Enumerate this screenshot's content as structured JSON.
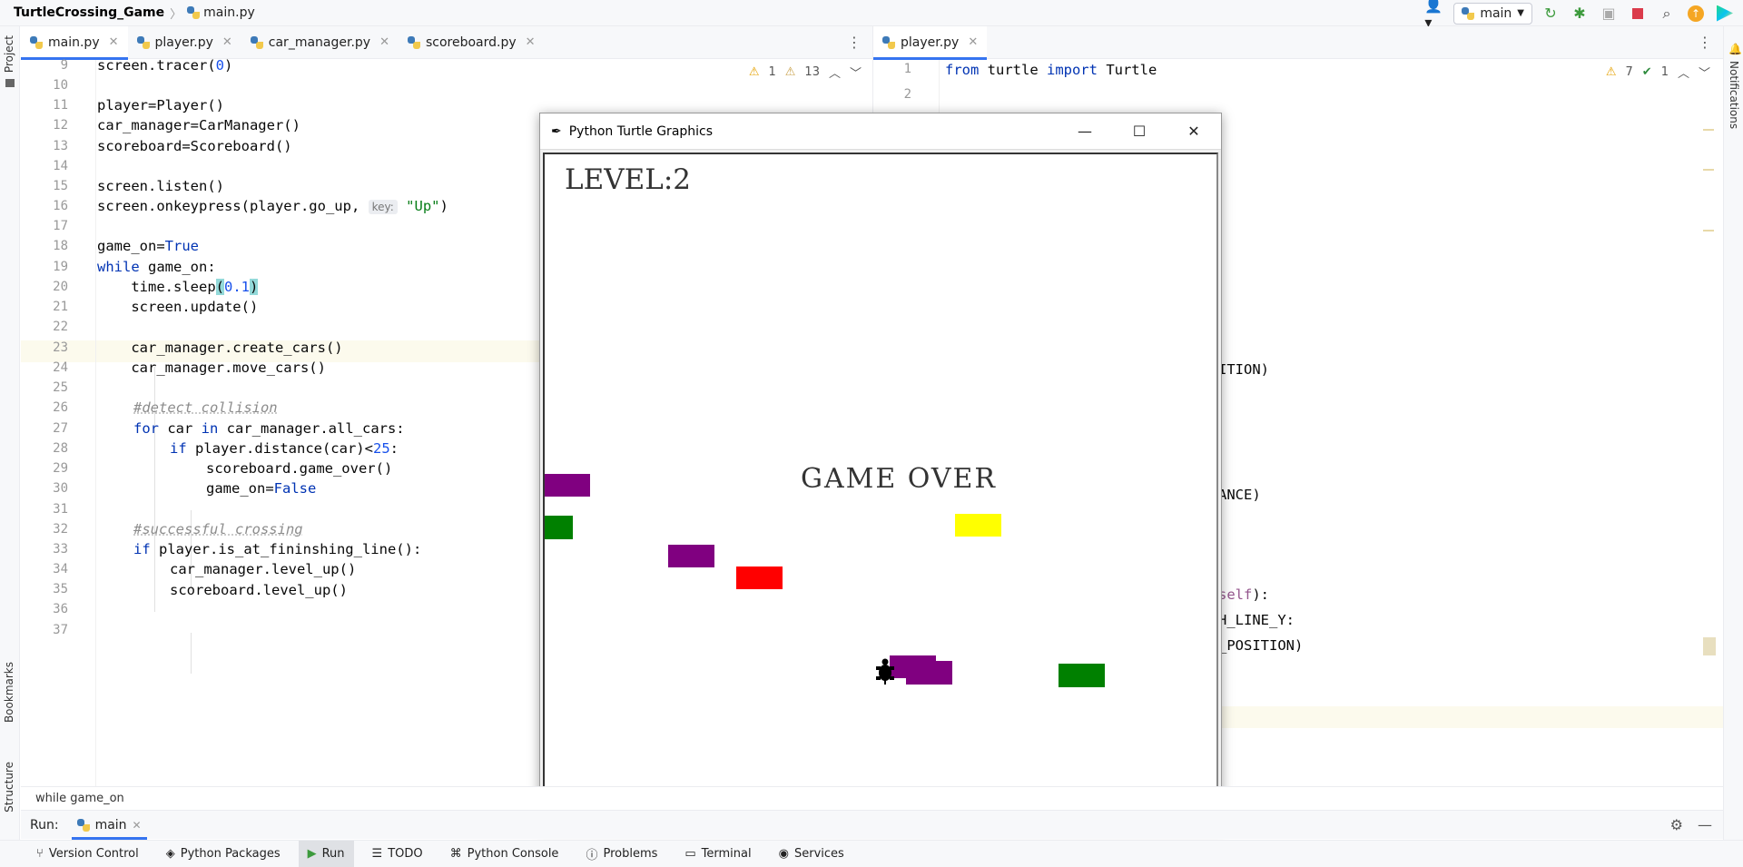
{
  "titlebar": {
    "project": "TurtleCrossing_Game",
    "file": "main.py",
    "branch": "main",
    "icons": [
      "user-icon",
      "run-icon",
      "debug-icon",
      "coverage-icon",
      "stop-icon",
      "search-icon",
      "update-icon",
      "ide-logo-icon"
    ]
  },
  "left_tool_labels": {
    "project": "Project",
    "bookmarks": "Bookmarks",
    "structure": "Structure"
  },
  "right_tool_labels": {
    "notifications": "Notifications"
  },
  "left_tabs": [
    {
      "label": "main.py",
      "active": true
    },
    {
      "label": "player.py",
      "active": false
    },
    {
      "label": "car_manager.py",
      "active": false
    },
    {
      "label": "scoreboard.py",
      "active": false
    }
  ],
  "right_tabs": [
    {
      "label": "player.py",
      "active": true
    }
  ],
  "left_editor": {
    "warnings": "1",
    "weak_warnings": "13",
    "line_numbers": [
      "9",
      "10",
      "11",
      "12",
      "13",
      "14",
      "15",
      "16",
      "17",
      "18",
      "19",
      "20",
      "21",
      "22",
      "23",
      "24",
      "25",
      "26",
      "27",
      "28",
      "29",
      "30",
      "31",
      "32",
      "33",
      "34",
      "35",
      "36",
      "37"
    ],
    "lines": {
      "l9": "screen.tracer(",
      "l9_num": "0",
      "l9_end": ")",
      "l11": "player=Player()",
      "l12": "car_manager=CarManager()",
      "l13": "scoreboard=Scoreboard()",
      "l15": "screen.listen()",
      "l16a": "screen.onkeypress(player.go_up, ",
      "l16_hint": "key:",
      "l16_str": "\"Up\"",
      "l16_end": ")",
      "l18a": "game_on=",
      "l18_kw": "True",
      "l19_kw": "while",
      "l19b": " game_on:",
      "l20a": "    time.sleep",
      "l20_open": "(",
      "l20_num": "0.1",
      "l20_close": ")",
      "l21": "    screen.update()",
      "l23": "    car_manager.create_cars()",
      "l24": "    car_manager.move_cars()",
      "l26": "#detect collision",
      "l27_kw1": "for",
      "l27b": " car ",
      "l27_kw2": "in",
      "l27c": " car_manager.all_cars:",
      "l28_kw": "if",
      "l28b": " player.distance(car)<",
      "l28_num": "25",
      "l28c": ":",
      "l29": "scoreboard.game_over()",
      "l30a": "game_on=",
      "l30_kw": "False",
      "l32": "#successful crossing",
      "l33_kw": "if",
      "l33b": " player.is_at_fininshing_line():",
      "l34": "car_manager.level_up()",
      "l35": "scoreboard.level_up()"
    }
  },
  "right_editor": {
    "warnings": "7",
    "checks": "1",
    "line_numbers": [
      "1",
      "2"
    ],
    "line1_kw1": "from",
    "line1_mid": " turtle ",
    "line1_kw2": "import",
    "line1_end": " Turtle",
    "frag_ition": "ITION)",
    "frag_ance": "ANCE)",
    "frag_self": "self",
    "frag_self_end": "):",
    "frag_line_y": "H_LINE_Y:",
    "frag_position": "_POSITION)"
  },
  "turtle_window": {
    "title": "Python Turtle Graphics",
    "minimize": "—",
    "maximize": "☐",
    "close": "✕",
    "level_text": "LEVEL:2",
    "game_over_text": "GAME OVER",
    "cars": [
      {
        "color": "#800080"
      },
      {
        "color": "#008000"
      },
      {
        "color": "#800080"
      },
      {
        "color": "#ff0000"
      },
      {
        "color": "#ffff00"
      },
      {
        "color": "#800080"
      },
      {
        "color": "#800080"
      },
      {
        "color": "#008000"
      }
    ]
  },
  "breadcrumb": "while game_on",
  "run_panel": {
    "label": "Run:",
    "config": "main"
  },
  "statusbar": [
    {
      "label": "Version Control",
      "icon": "branch-icon"
    },
    {
      "label": "Python Packages",
      "icon": "packages-icon"
    },
    {
      "label": "Run",
      "icon": "run-icon",
      "active": true
    },
    {
      "label": "TODO",
      "icon": "list-icon"
    },
    {
      "label": "Python Console",
      "icon": "console-icon"
    },
    {
      "label": "Problems",
      "icon": "problems-icon"
    },
    {
      "label": "Terminal",
      "icon": "terminal-icon"
    },
    {
      "label": "Services",
      "icon": "services-icon"
    }
  ]
}
